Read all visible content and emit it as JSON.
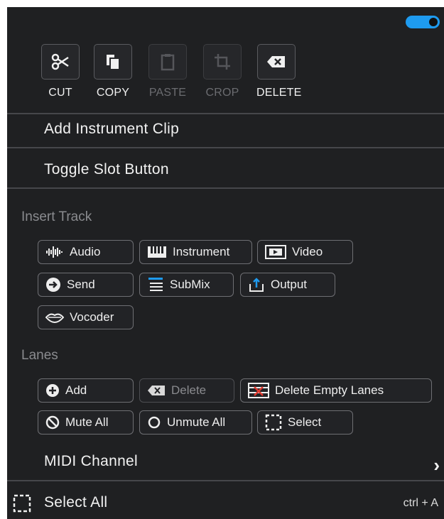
{
  "toggle": {
    "state": "on",
    "color": "#1e9bf0"
  },
  "toolbar": {
    "cut": {
      "label": "CUT",
      "icon": "scissors-icon",
      "enabled": true
    },
    "copy": {
      "label": "COPY",
      "icon": "copy-icon",
      "enabled": true
    },
    "paste": {
      "label": "PASTE",
      "icon": "clipboard-icon",
      "enabled": false
    },
    "crop": {
      "label": "CROP",
      "icon": "crop-icon",
      "enabled": false
    },
    "delete": {
      "label": "DELETE",
      "icon": "backspace-icon",
      "enabled": true
    }
  },
  "menu": {
    "add_instrument_clip": "Add Instrument Clip",
    "toggle_slot_button": "Toggle Slot Button"
  },
  "insert_track": {
    "title": "Insert Track",
    "audio": "Audio",
    "instrument": "Instrument",
    "video": "Video",
    "send": "Send",
    "submix": "SubMix",
    "output": "Output",
    "vocoder": "Vocoder"
  },
  "lanes": {
    "title": "Lanes",
    "add": "Add",
    "delete": "Delete",
    "delete_empty": "Delete Empty Lanes",
    "mute_all": "Mute All",
    "unmute_all": "Unmute All",
    "select": "Select"
  },
  "midi_channel": {
    "label": "MIDI Channel",
    "chevron": "›"
  },
  "select_all": {
    "label": "Select All",
    "shortcut": "ctrl + A"
  },
  "colors": {
    "background": "#1f2022",
    "accent": "#1e9bf0",
    "disabled": "#6b6c70"
  }
}
